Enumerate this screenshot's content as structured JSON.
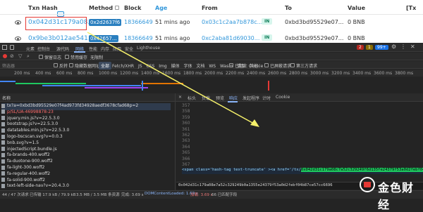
{
  "page": {
    "headers": [
      "Txn Hash",
      "Method",
      "Block",
      "Age",
      "From",
      "To",
      "Value",
      "[Tx"
    ],
    "rows": [
      {
        "hash": "0x042d31c179a08...",
        "method": "0x2d2637f6",
        "block": "18366649",
        "age": "51 mins ago",
        "from": "0x03c1c2aa7b878c...",
        "dir": "IN",
        "to": "0xbd3bd95529e07...",
        "value": "0 BNB"
      },
      {
        "hash": "0x9be3b012ae541...",
        "method": "0x42657...",
        "block": "18366649",
        "age": "51 mins ago",
        "from": "0xc2aba81d69030...",
        "dir": "IN",
        "to": "0xbd3bd95529e07...",
        "value": "0 BNB"
      }
    ]
  },
  "devtools": {
    "top_tabs": [
      "元素",
      "控制台",
      "源代码",
      "网络",
      "性能",
      "内存",
      "应用",
      "安全",
      "Lighthouse"
    ],
    "active_top_tab": "网络",
    "badges": {
      "errors": "2",
      "warnings": "1",
      "info": "99+"
    },
    "toolbar": {
      "preserve_log": "保留日志",
      "disable_cache": "禁用缓存",
      "throttle": "无限制"
    },
    "filter": {
      "placeholder": "筛选器",
      "invert": "反转",
      "hide_data_urls": "隐藏数据网址",
      "all": "全部",
      "types": [
        "Fetch/XHR",
        "JS",
        "CSS",
        "Img",
        "媒体",
        "字体",
        "文档",
        "WS",
        "Wasm",
        "清单",
        "其他"
      ],
      "blocked_cookies": "已阻止 Cookie",
      "blocked_requests": "已屏蔽请求",
      "third_party": "第三方请求"
    },
    "ticks": [
      "200 ms",
      "400 ms",
      "600 ms",
      "800 ms",
      "1000 ms",
      "1200 ms",
      "1400 ms",
      "1600 ms",
      "1800 ms",
      "2000 ms",
      "2200 ms",
      "2400 ms",
      "2600 ms",
      "2800 ms",
      "3000 ms",
      "3200 ms",
      "3400 ms",
      "3600 ms",
      "3800 ms"
    ],
    "file_header": "名称",
    "files": [
      "tx?a=0xbd3bd95529e07f4ad973fd34928aedf3678cfad68p=2",
      "p/SL/UA-46998878-23",
      "jquery.min.js?v=22.5.3.0",
      "bootstrap.js?v=22.5.3.0",
      "datatables.min.js?v=22.5.3.0",
      "logo-bscscan.svg?v=0.0.3",
      "bnb.svg?v=1.5",
      "injectedScript.bundle.js",
      "fa-brands-400.woff2",
      "fa-duotone-900.woff2",
      "fa-light-300.woff2",
      "fa-regular-400.woff2",
      "fa-solid-900.woff2",
      "text-left-side-nav?v=20.4.3.0"
    ],
    "sub_tabs": [
      "标头",
      "负载",
      "预览",
      "响应",
      "发起程序",
      "计时",
      "Cookie"
    ],
    "active_sub_tab": "响应",
    "line_numbers": [
      "357",
      "358",
      "359",
      "360",
      "361",
      "362",
      "363",
      "364",
      "365",
      "366",
      "367"
    ],
    "code_prefix": "<span class='hash-tag text-truncate' ><a href='/tx/",
    "code_highlight": "0x042d31c179a08c7a52c329249f6d135fe24379f53a0d2febf04b87ce57cc6696",
    "search_result": "0x042d31c179a08e7a52c329249b0a1355e24379f53a0d2febf04b87ce57cc6696",
    "status": {
      "requests": "44 / 47 次请求",
      "transferred": "已传输 17.9 kB / 79.9 kB",
      "resources": "3.5 MB / 3.5 MB 条资源",
      "finish": "完成: 3.69 s",
      "dcl": "DOMContentLoaded: 1.69 s",
      "load": "加载: 3.69 s",
      "match": "66 已匹配字段"
    },
    "watermark": "金色财经"
  },
  "colors": {
    "accent": "#3498db",
    "highlight": "#1ec85f",
    "red_box": "#e53935",
    "arrow": "#f5f06a"
  }
}
